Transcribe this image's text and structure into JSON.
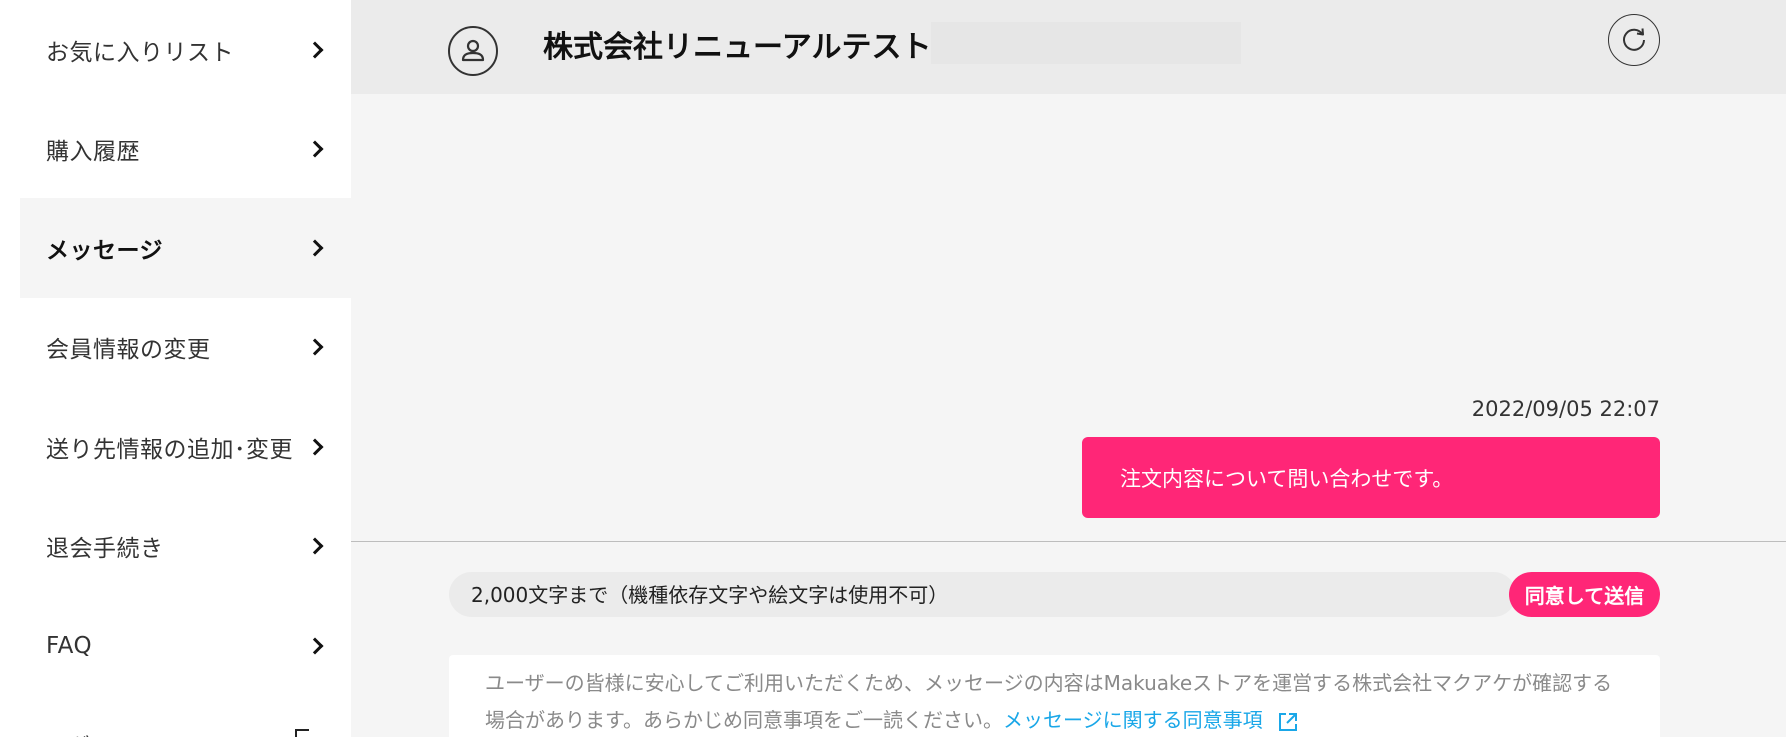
{
  "sidebar": {
    "items": [
      {
        "label": "お気に入りリスト",
        "active": false
      },
      {
        "label": "購入履歴",
        "active": false
      },
      {
        "label": "メッセージ",
        "active": true
      },
      {
        "label": "会員情報の変更",
        "active": false
      },
      {
        "label": "送り先情報の追加･変更",
        "active": false
      },
      {
        "label": "退会手続き",
        "active": false
      },
      {
        "label": "FAQ",
        "active": false
      }
    ],
    "partial_label": "ログ"
  },
  "header": {
    "shop_name": "株式会社リニューアルテスト",
    "avatar_icon": "user-icon",
    "refresh_icon": "refresh-icon"
  },
  "message": {
    "timestamp": "2022/09/05 22:07",
    "text": "注文内容について問い合わせです。"
  },
  "composer": {
    "placeholder": "2,000文字まで（機種依存文字や絵文字は使用不可）",
    "send_label": "同意して送信"
  },
  "notice": {
    "text": "ユーザーの皆様に安心してご利用いただくため、メッセージの内容はMakuakeストアを運営する株式会社マクアケが確認する場合があります。あらかじめ同意事項をご一読ください。",
    "link_label": "メッセージに関する同意事項",
    "link_icon": "external-link-icon"
  },
  "colors": {
    "accent": "#ff2677",
    "link": "#1aa7e8"
  }
}
